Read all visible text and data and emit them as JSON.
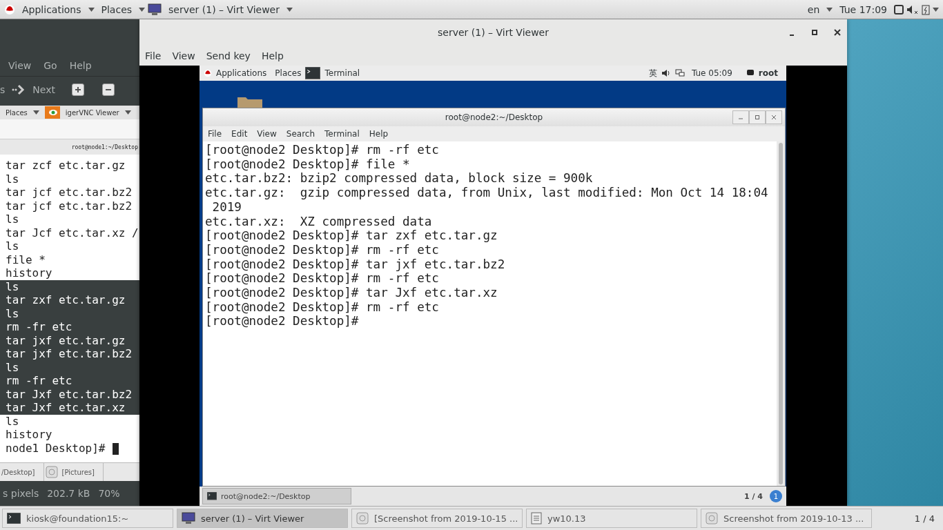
{
  "top_bar": {
    "applications": "Applications",
    "places": "Places",
    "window": "server (1) – Virt Viewer",
    "language": "en",
    "clock": "Tue 17:09"
  },
  "back_window": {
    "menu": [
      "View",
      "Go",
      "Help"
    ],
    "toolbar_fragment": "s",
    "next": "Next",
    "screenshot": {
      "places": "Places",
      "app": "igerVNC Viewer",
      "terminal_title": "root@node1:~/Desktop",
      "lines": [
        {
          "text": "tar zcf etc.tar.gz",
          "selected": false
        },
        {
          "text": "ls",
          "selected": false
        },
        {
          "text": "tar jcf etc.tar.bz2",
          "selected": false
        },
        {
          "text": "tar jcf etc.tar.bz2",
          "selected": false
        },
        {
          "text": "ls",
          "selected": false
        },
        {
          "text": "tar Jcf etc.tar.xz /",
          "selected": false
        },
        {
          "text": "ls",
          "selected": false
        },
        {
          "text": "file *",
          "selected": false
        },
        {
          "text": "history",
          "selected": false
        },
        {
          "text": "ls",
          "selected": true
        },
        {
          "text": "tar zxf etc.tar.gz",
          "selected": true
        },
        {
          "text": "ls",
          "selected": true
        },
        {
          "text": "rm -fr etc",
          "selected": true
        },
        {
          "text": "tar jxf etc.tar.gz",
          "selected": true
        },
        {
          "text": "tar jxf etc.tar.bz2",
          "selected": true
        },
        {
          "text": "ls",
          "selected": true
        },
        {
          "text": "rm -fr etc",
          "selected": true
        },
        {
          "text": "tar Jxf etc.tar.bz2",
          "selected": true
        },
        {
          "text": "tar Jxf etc.tar.xz",
          "selected": true
        },
        {
          "text": "ls",
          "selected": false
        },
        {
          "text": "history",
          "selected": false
        }
      ],
      "prompt": "node1 Desktop]#",
      "tasks": [
        "/Desktop]",
        "[Pictures]"
      ]
    },
    "status": [
      "s pixels",
      "202.7 kB",
      "70%"
    ]
  },
  "viewer": {
    "title": "server (1) – Virt Viewer",
    "menu": [
      "File",
      "View",
      "Send key",
      "Help"
    ],
    "guest": {
      "top_bar": {
        "applications": "Applications",
        "places": "Places",
        "window": "Terminal",
        "input_method": "英",
        "clock": "Tue 05:09",
        "user": "root"
      },
      "terminal": {
        "title": "root@node2:~/Desktop",
        "menu": [
          "File",
          "Edit",
          "View",
          "Search",
          "Terminal",
          "Help"
        ],
        "lines": [
          "[root@node2 Desktop]# rm -rf etc",
          "[root@node2 Desktop]# file *",
          "etc.tar.bz2: bzip2 compressed data, block size = 900k",
          "etc.tar.gz:  gzip compressed data, from Unix, last modified: Mon Oct 14 18:04",
          " 2019",
          "etc.tar.xz:  XZ compressed data",
          "[root@node2 Desktop]# tar zxf etc.tar.gz",
          "[root@node2 Desktop]# rm -rf etc",
          "[root@node2 Desktop]# tar jxf etc.tar.bz2",
          "[root@node2 Desktop]# rm -rf etc",
          "[root@node2 Desktop]# tar Jxf etc.tar.xz",
          "[root@node2 Desktop]# rm -rf etc",
          "[root@node2 Desktop]# "
        ]
      },
      "taskbar": {
        "task": "root@node2:~/Desktop",
        "workspace": "1 / 4",
        "badge": "1"
      }
    }
  },
  "taskbar": {
    "items": [
      {
        "label": "kiosk@foundation15:~",
        "selected": false
      },
      {
        "label": "server (1) – Virt Viewer",
        "selected": true
      },
      {
        "label": "[Screenshot from 2019-10-15 ...",
        "selected": false
      },
      {
        "label": "yw10.13",
        "selected": false
      },
      {
        "label": "Screenshot from 2019-10-13 ...",
        "selected": false
      }
    ],
    "workspace": "1 / 4"
  }
}
